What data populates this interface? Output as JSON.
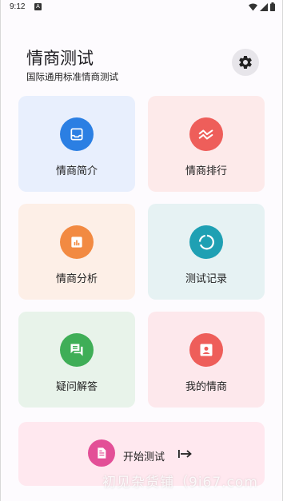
{
  "status_bar": {
    "time": "9:12",
    "notification_glyph": "A"
  },
  "header": {
    "title": "情商测试",
    "subtitle": "国际通用标准情商测试"
  },
  "cards": [
    {
      "label": "情商简介",
      "icon": "inbox-icon",
      "bg": "#e8effd",
      "accent": "#2b7fe3"
    },
    {
      "label": "情商排行",
      "icon": "trend-icon",
      "bg": "#fdeaea",
      "accent": "#ee5e5a"
    },
    {
      "label": "情商分析",
      "icon": "bar-chart-icon",
      "bg": "#fdefe7",
      "accent": "#f28a42"
    },
    {
      "label": "测试记录",
      "icon": "progress-ring-icon",
      "bg": "#e6f2f3",
      "accent": "#1fa0b3"
    },
    {
      "label": "疑问解答",
      "icon": "chat-icon",
      "bg": "#e8f3ea",
      "accent": "#3fae57"
    },
    {
      "label": "我的情商",
      "icon": "person-icon",
      "bg": "#fde8ec",
      "accent": "#ee5e5a"
    }
  ],
  "start": {
    "label": "开始测试",
    "icon": "document-icon",
    "accent": "#e34f97"
  },
  "watermark": "初见杂货铺（9i67.com"
}
